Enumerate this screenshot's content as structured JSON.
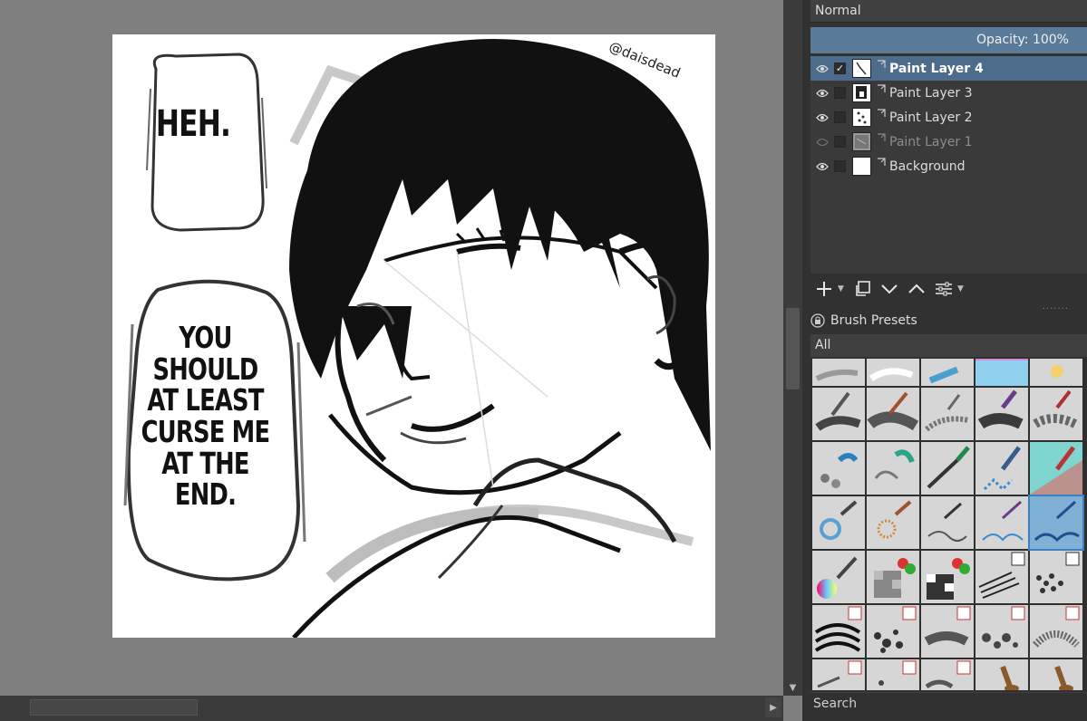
{
  "canvas": {
    "bubble1_lines": [
      "HEH."
    ],
    "bubble2_lines": [
      "YOU",
      "SHOULD",
      "AT LEAST",
      "CURSE ME",
      "AT THE",
      "END."
    ],
    "signature": "@daisdead"
  },
  "layers_docker": {
    "blend_mode": "Normal",
    "opacity_label": "Opacity: 100%",
    "layers": [
      {
        "name": "Paint Layer 4",
        "visible": true,
        "checked": "✓",
        "active": true
      },
      {
        "name": "Paint Layer 3",
        "visible": true,
        "checked": "",
        "active": false
      },
      {
        "name": "Paint Layer 2",
        "visible": true,
        "checked": "",
        "active": false
      },
      {
        "name": "Paint Layer 1",
        "visible": false,
        "checked": "",
        "active": false
      },
      {
        "name": "Background",
        "visible": true,
        "checked": "",
        "active": false
      }
    ]
  },
  "brush_presets": {
    "title": "Brush Presets",
    "tag_filter": "All",
    "search_placeholder": "Search"
  },
  "colors": {
    "accent_selection": "#5a7a9a",
    "active_layer": "#4d6b8a",
    "panel_bg": "#313131",
    "canvas_bg": "#7f7f7f"
  }
}
